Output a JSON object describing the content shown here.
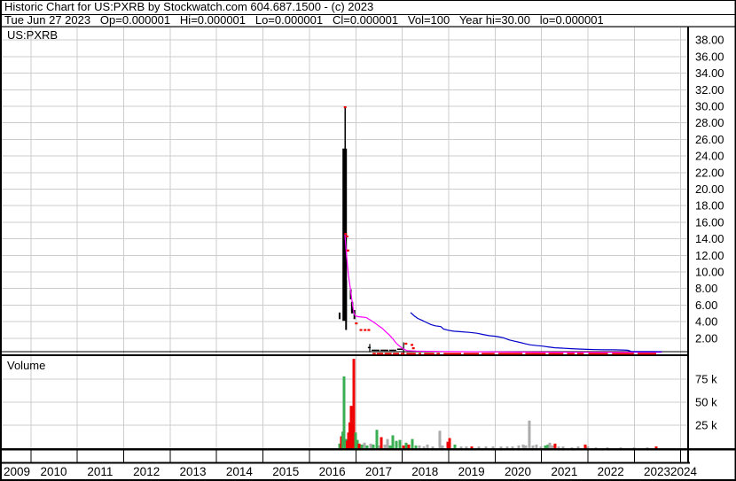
{
  "header": {
    "title": "Historic Chart for US:PXRB by Stockwatch.com 604.687.1500 - (c) 2023",
    "quote_line": "Tue Jun 27 2023   Op=0.000001   Hi=0.000001   Lo=0.000001   Cl=0.000001   Vol=100   Year hi=30.00   lo=0.000001"
  },
  "chart_data": {
    "type": "line",
    "symbol": "US:PXRB",
    "colors": {
      "g": "#3aae52",
      "r": "#ee0000",
      "n": "#ababab",
      "ma_fast": "#ff00ff",
      "ma_slow": "#0000cc",
      "grid": "#cccccc",
      "axis": "#000000"
    },
    "price_panel": {
      "label": "US:PXRB",
      "ticks": [
        [
          38,
          "38.00"
        ],
        [
          36,
          "36.00"
        ],
        [
          34,
          "34.00"
        ],
        [
          32,
          "32.00"
        ],
        [
          30,
          "30.00"
        ],
        [
          28,
          "28.00"
        ],
        [
          26,
          "26.00"
        ],
        [
          24,
          "24.00"
        ],
        [
          22,
          "22.00"
        ],
        [
          20,
          "20.00"
        ],
        [
          18,
          "18.00"
        ],
        [
          16,
          "16.00"
        ],
        [
          14,
          "14.00"
        ],
        [
          12,
          "12.00"
        ],
        [
          10,
          "10.00"
        ],
        [
          8,
          "8.00"
        ],
        [
          6,
          "6.00"
        ],
        [
          4,
          "4.00"
        ],
        [
          2,
          "2.00"
        ]
      ],
      "year_high": 30.0,
      "year_low": 1e-06,
      "bars": [
        [
          2016.78,
          29.9,
          24.7,
          1.5
        ],
        [
          2016.77,
          24.9,
          4.1,
          5
        ],
        [
          2016.8,
          9.0,
          3.0,
          2
        ],
        [
          2016.66,
          5.1,
          4.3,
          2
        ],
        [
          2016.9,
          7.9,
          6.7,
          2
        ],
        [
          2016.93,
          6.4,
          5.0,
          2.5
        ],
        [
          2016.98,
          5.4,
          4.3,
          2
        ],
        [
          2017.31,
          1.3,
          0.3,
          1.2
        ],
        [
          2018.04,
          1.5,
          0.2,
          1.2
        ]
      ],
      "black_dashes": [
        [
          2017.27,
          2017.33,
          0.95
        ],
        [
          2017.35,
          2017.52,
          0.62
        ],
        [
          2017.54,
          2017.71,
          0.62
        ],
        [
          2017.73,
          2017.88,
          0.62
        ],
        [
          2017.9,
          2018.02,
          0.75
        ]
      ],
      "red_marks": [
        [
          2016.78,
          29.9
        ],
        [
          2016.79,
          14.6
        ],
        [
          2016.82,
          14.3
        ],
        [
          2016.84,
          12.6
        ],
        [
          2017.02,
          3.8
        ],
        [
          2017.12,
          3.0
        ],
        [
          2017.21,
          3.0
        ],
        [
          2017.29,
          3.0
        ],
        [
          2018.09,
          1.35
        ],
        [
          2018.22,
          1.2
        ],
        [
          2018.25,
          0.8
        ]
      ],
      "red_dashes": [
        [
          2017.37,
          2017.44
        ],
        [
          2017.46,
          2017.6
        ],
        [
          2017.63,
          2017.78
        ],
        [
          2017.81,
          2017.94
        ],
        [
          2017.98,
          2018.06
        ],
        [
          2018.1,
          2018.3
        ],
        [
          2018.36,
          2018.42
        ],
        [
          2018.48,
          2018.7
        ],
        [
          2018.75,
          2018.82
        ],
        [
          2018.9,
          2019.28
        ],
        [
          2019.33,
          2019.66
        ],
        [
          2019.72,
          2020.0
        ],
        [
          2020.08,
          2020.6
        ],
        [
          2020.66,
          2021.1
        ],
        [
          2021.16,
          2021.48
        ],
        [
          2021.56,
          2021.72
        ],
        [
          2021.78,
          2021.92
        ],
        [
          2022.02,
          2022.44
        ],
        [
          2022.53,
          2023.0
        ],
        [
          2023.08,
          2023.48
        ]
      ],
      "ma_fast": {
        "points": [
          [
            2016.775,
            14.5
          ],
          [
            2016.81,
            12.0
          ],
          [
            2016.85,
            9.6
          ],
          [
            2016.89,
            8.1
          ],
          [
            2016.93,
            6.4
          ],
          [
            2016.97,
            5.0
          ],
          [
            2017.0,
            4.7
          ],
          [
            2017.06,
            4.6
          ],
          [
            2017.16,
            4.55
          ],
          [
            2017.23,
            4.5
          ],
          [
            2017.29,
            4.3
          ],
          [
            2017.35,
            4.1
          ],
          [
            2017.43,
            3.8
          ],
          [
            2017.5,
            3.5
          ],
          [
            2017.58,
            3.2
          ],
          [
            2017.65,
            2.8
          ],
          [
            2017.73,
            2.4
          ],
          [
            2017.81,
            1.9
          ],
          [
            2017.88,
            1.4
          ],
          [
            2017.96,
            1.0
          ],
          [
            2018.04,
            0.7
          ],
          [
            2018.11,
            0.5
          ],
          [
            2018.32,
            0.45
          ],
          [
            2018.9,
            0.4
          ],
          [
            2019.85,
            0.35
          ],
          [
            2020.81,
            0.32
          ],
          [
            2021.76,
            0.3
          ],
          [
            2022.72,
            0.3
          ],
          [
            2023.6,
            0.3
          ]
        ]
      },
      "ma_slow": {
        "points": [
          [
            2018.19,
            5.1
          ],
          [
            2018.27,
            4.7
          ],
          [
            2018.34,
            4.4
          ],
          [
            2018.44,
            4.15
          ],
          [
            2018.53,
            3.9
          ],
          [
            2018.63,
            3.65
          ],
          [
            2018.72,
            3.5
          ],
          [
            2018.84,
            3.4
          ],
          [
            2018.9,
            3.1
          ],
          [
            2019.01,
            2.95
          ],
          [
            2019.12,
            2.85
          ],
          [
            2019.28,
            2.78
          ],
          [
            2019.47,
            2.7
          ],
          [
            2019.62,
            2.6
          ],
          [
            2019.75,
            2.45
          ],
          [
            2019.89,
            2.3
          ],
          [
            2020.0,
            2.25
          ],
          [
            2020.1,
            2.15
          ],
          [
            2020.19,
            2.05
          ],
          [
            2020.31,
            1.8
          ],
          [
            2020.42,
            1.65
          ],
          [
            2020.54,
            1.5
          ],
          [
            2020.65,
            1.35
          ],
          [
            2020.77,
            1.2
          ],
          [
            2020.92,
            1.1
          ],
          [
            2021.03,
            1.05
          ],
          [
            2021.15,
            0.95
          ],
          [
            2021.3,
            0.85
          ],
          [
            2021.45,
            0.8
          ],
          [
            2021.61,
            0.75
          ],
          [
            2021.8,
            0.7
          ],
          [
            2021.99,
            0.65
          ],
          [
            2022.18,
            0.62
          ],
          [
            2022.37,
            0.6
          ],
          [
            2022.56,
            0.6
          ],
          [
            2022.75,
            0.58
          ],
          [
            2022.87,
            0.55
          ],
          [
            2022.95,
            0.4
          ],
          [
            2023.14,
            0.38
          ],
          [
            2023.37,
            0.38
          ],
          [
            2023.6,
            0.37
          ]
        ]
      }
    },
    "volume_panel": {
      "label": "Volume",
      "ticks": [
        [
          75,
          "75 k"
        ],
        [
          50,
          "50 k"
        ],
        [
          25,
          "25 k"
        ]
      ],
      "bars": [
        [
          2016.661,
          5,
          "g"
        ],
        [
          2016.699,
          13,
          "r"
        ],
        [
          2016.728,
          18,
          "g"
        ],
        [
          2016.756,
          78,
          "g"
        ],
        [
          2016.795,
          10,
          "g"
        ],
        [
          2016.823,
          8,
          "r"
        ],
        [
          2016.852,
          17,
          "r"
        ],
        [
          2016.881,
          28,
          "r"
        ],
        [
          2016.909,
          46,
          "r"
        ],
        [
          2016.938,
          25,
          "r"
        ],
        [
          2016.967,
          97,
          "r"
        ],
        [
          2017.005,
          17,
          "g"
        ],
        [
          2017.043,
          9,
          "g"
        ],
        [
          2017.081,
          5,
          "r"
        ],
        [
          2017.139,
          4,
          "g"
        ],
        [
          2017.196,
          6,
          "n"
        ],
        [
          2017.253,
          3,
          "g"
        ],
        [
          2017.33,
          5,
          "n"
        ],
        [
          2017.387,
          4,
          "g"
        ],
        [
          2017.463,
          20,
          "g"
        ],
        [
          2017.521,
          3,
          "n"
        ],
        [
          2017.559,
          12,
          "r"
        ],
        [
          2017.635,
          4,
          "n"
        ],
        [
          2017.693,
          10,
          "n"
        ],
        [
          2017.75,
          3,
          "g"
        ],
        [
          2017.807,
          14,
          "g"
        ],
        [
          2017.884,
          8,
          "g"
        ],
        [
          2017.96,
          9,
          "g"
        ],
        [
          2018.036,
          3,
          "r"
        ],
        [
          2018.094,
          6,
          "g"
        ],
        [
          2018.151,
          4,
          "r"
        ],
        [
          2018.227,
          10,
          "g"
        ],
        [
          2018.304,
          3,
          "g"
        ],
        [
          2018.38,
          3,
          "n"
        ],
        [
          2018.476,
          2,
          "n"
        ],
        [
          2018.552,
          4,
          "n"
        ],
        [
          2018.667,
          2,
          "n"
        ],
        [
          2018.819,
          19,
          "n"
        ],
        [
          2018.877,
          3,
          "n"
        ],
        [
          2018.991,
          7,
          "r"
        ],
        [
          2019.03,
          11,
          "r"
        ],
        [
          2019.144,
          4,
          "g"
        ],
        [
          2019.278,
          2,
          "n"
        ],
        [
          2019.392,
          2,
          "n"
        ],
        [
          2019.507,
          2,
          "r"
        ],
        [
          2019.66,
          2,
          "n"
        ],
        [
          2019.813,
          2,
          "n"
        ],
        [
          2019.965,
          2,
          "n"
        ],
        [
          2020.137,
          2,
          "n"
        ],
        [
          2020.271,
          2,
          "n"
        ],
        [
          2020.386,
          2,
          "n"
        ],
        [
          2020.519,
          3,
          "n"
        ],
        [
          2020.615,
          4,
          "n"
        ],
        [
          2020.672,
          3,
          "n"
        ],
        [
          2020.748,
          30,
          "n"
        ],
        [
          2020.825,
          3,
          "n"
        ],
        [
          2020.901,
          4,
          "n"
        ],
        [
          2020.997,
          2,
          "n"
        ],
        [
          2021.092,
          3,
          "g"
        ],
        [
          2021.15,
          4,
          "g"
        ],
        [
          2021.188,
          6,
          "n"
        ],
        [
          2021.245,
          3,
          "n"
        ],
        [
          2021.302,
          5,
          "r"
        ],
        [
          2021.379,
          2,
          "n"
        ],
        [
          2021.474,
          2,
          "n"
        ],
        [
          2021.665,
          1,
          "n"
        ],
        [
          2021.799,
          2,
          "n"
        ],
        [
          2021.952,
          4,
          "r"
        ],
        [
          2022.009,
          2,
          "n"
        ],
        [
          2022.181,
          1,
          "n"
        ],
        [
          2022.429,
          1,
          "n"
        ],
        [
          2022.716,
          1,
          "n"
        ],
        [
          2023.003,
          1,
          "n"
        ],
        [
          2023.289,
          1,
          "n"
        ],
        [
          2023.48,
          2,
          "r"
        ]
      ]
    },
    "x_axis": {
      "years": [
        "2009",
        "2010",
        "2011",
        "2012",
        "2013",
        "2014",
        "2015",
        "2016",
        "2017",
        "2018",
        "2019",
        "2020",
        "2021",
        "2022",
        "2023",
        "2024"
      ]
    }
  }
}
